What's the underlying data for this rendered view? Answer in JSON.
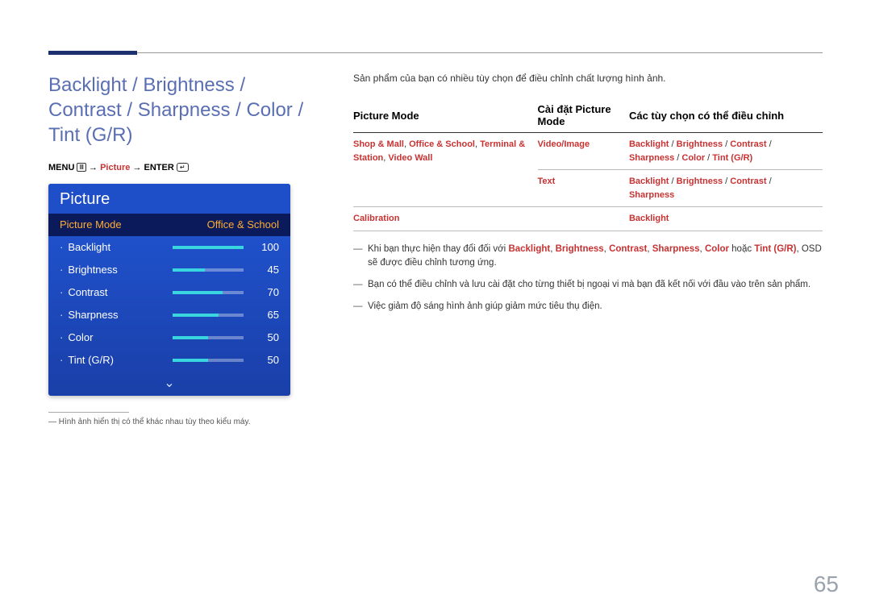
{
  "pageNumber": "65",
  "title": "Backlight / Brightness / Contrast / Sharpness / Color / Tint (G/R)",
  "menuPath": {
    "menu": "MENU",
    "picture": "Picture",
    "enter": "ENTER",
    "arrow": "→"
  },
  "osd": {
    "title": "Picture",
    "modeRow": {
      "label": "Picture Mode",
      "value": "Office & School"
    },
    "rows": [
      {
        "label": "Backlight",
        "value": 100,
        "pct": 100
      },
      {
        "label": "Brightness",
        "value": 45,
        "pct": 45
      },
      {
        "label": "Contrast",
        "value": 70,
        "pct": 70
      },
      {
        "label": "Sharpness",
        "value": 65,
        "pct": 65
      },
      {
        "label": "Color",
        "value": 50,
        "pct": 50
      },
      {
        "label": "Tint (G/R)",
        "value": 50,
        "pct": 50
      }
    ],
    "moreGlyph": "⌄"
  },
  "footnote": "Hình ảnh hiển thị có thể khác nhau tùy theo kiểu máy.",
  "intro": "Sản phẩm của bạn có nhiều tùy chọn để điều chỉnh chất lượng hình ảnh.",
  "table": {
    "headers": [
      "Picture Mode",
      "Cài đặt Picture Mode",
      "Các tùy chọn có thể điều chỉnh"
    ],
    "rows": [
      {
        "c0": "Shop & Mall, Office & School, Terminal & Station, Video Wall",
        "c1": "Video/Image",
        "c2": "Backlight /  Brightness / Contrast / Sharpness / Color / Tint (G/R)"
      },
      {
        "c0": "",
        "c1": "Text",
        "c2": "Backlight / Brightness / Contrast / Sharpness"
      },
      {
        "c0": "Calibration",
        "c1": "",
        "c2": "Backlight"
      }
    ]
  },
  "notes": {
    "n1_pre": "Khi bạn thực hiện thay đổi đối với ",
    "n1_kw": [
      "Backlight",
      "Brightness",
      "Contrast",
      "Sharpness",
      "Color",
      "Tint (G/R)"
    ],
    "n1_join": ", ",
    "n1_or": " hoặc ",
    "n1_post": ", OSD sẽ được điều chỉnh tương ứng.",
    "n2": "Bạn có thể điều chỉnh và lưu cài đặt cho từng thiết bị ngoại vi mà bạn đã kết nối với đầu vào trên sản phẩm.",
    "n3": "Việc giảm độ sáng hình ảnh giúp giảm mức tiêu thụ điện."
  }
}
